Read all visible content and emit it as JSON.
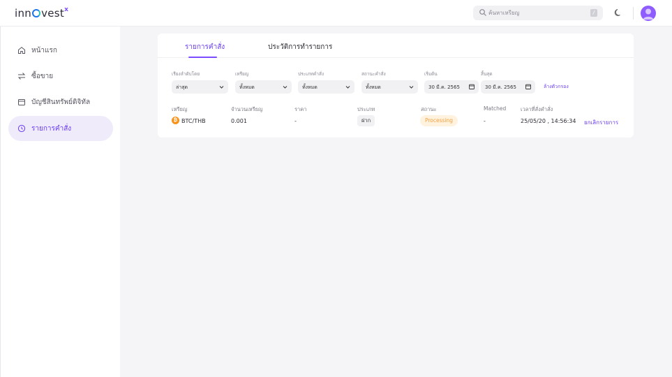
{
  "header": {
    "logo_text": "inn",
    "logo_text_2": "vest",
    "logo_sup": "x",
    "search_placeholder": "ค้นหาเหรียญ",
    "search_shortcut": "/"
  },
  "sidebar": {
    "items": [
      {
        "label": "หน้าแรก",
        "icon": "home-icon"
      },
      {
        "label": "ซื้อขาย",
        "icon": "swap-icon"
      },
      {
        "label": "บัญชีสินทรัพย์ดิจิทัล",
        "icon": "wallet-icon"
      },
      {
        "label": "รายการคำสั่ง",
        "icon": "clock-icon",
        "active": true
      }
    ]
  },
  "tabs": [
    {
      "label": "รายการคำสั่ง",
      "active": true
    },
    {
      "label": "ประวัติการทำรายการ",
      "active": false
    }
  ],
  "filters": {
    "sort": {
      "label": "เรียงลำดับโดย",
      "value": "ล่าสุด"
    },
    "coin": {
      "label": "เหรียญ",
      "value": "ทั้งหมด"
    },
    "order_type": {
      "label": "ประเภทคำสั่ง",
      "value": "ทั้งหมด"
    },
    "order_status": {
      "label": "สถานะคำสั่ง",
      "value": "ทั้งหมด"
    },
    "start": {
      "label": "เริ่มต้น",
      "value": "30 มี.ค. 2565"
    },
    "end": {
      "label": "สิ้นสุด",
      "value": "30 มี.ค. 2565"
    },
    "clear_label": "ล้างตัวกรอง"
  },
  "table": {
    "columns": [
      "เหรียญ",
      "จำนวนเหรียญ",
      "ราคา",
      "ประเภท",
      "สถานะ",
      "Matched",
      "เวลาที่สั่งคำสั่ง"
    ],
    "rows": [
      {
        "coin": "BTC/THB",
        "coin_symbol": "₿",
        "amount": "0.001",
        "price": "-",
        "type": "ฝาก",
        "status": "Processing",
        "matched": "-",
        "time": "25/05/20 , 14:56:34",
        "action": "ยกเลิกรายการ"
      }
    ]
  },
  "colors": {
    "accent": "#6a3df5",
    "status_processing": "#f4a040",
    "btc": "#f7931a"
  }
}
